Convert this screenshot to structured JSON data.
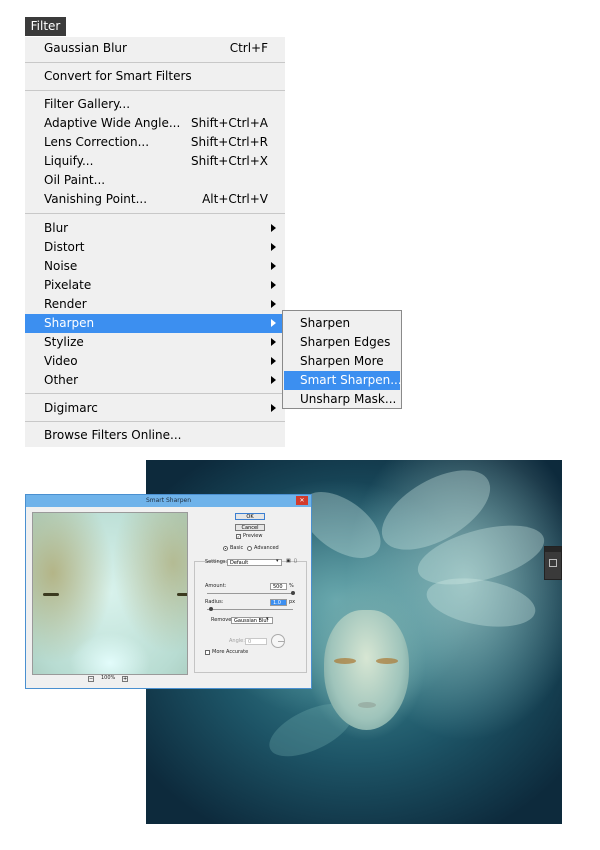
{
  "menubar": {
    "filter_label": "Filter"
  },
  "filter_menu": {
    "items": [
      {
        "label": "Gaussian Blur",
        "shortcut": "Ctrl+F"
      },
      {
        "label": "Convert for Smart Filters",
        "shortcut": ""
      },
      {
        "label": "Filter Gallery...",
        "shortcut": ""
      },
      {
        "label": "Adaptive Wide Angle...",
        "shortcut": "Shift+Ctrl+A"
      },
      {
        "label": "Lens Correction...",
        "shortcut": "Shift+Ctrl+R"
      },
      {
        "label": "Liquify...",
        "shortcut": "Shift+Ctrl+X"
      },
      {
        "label": "Oil Paint...",
        "shortcut": ""
      },
      {
        "label": "Vanishing Point...",
        "shortcut": "Alt+Ctrl+V"
      },
      {
        "label": "Blur",
        "shortcut": ""
      },
      {
        "label": "Distort",
        "shortcut": ""
      },
      {
        "label": "Noise",
        "shortcut": ""
      },
      {
        "label": "Pixelate",
        "shortcut": ""
      },
      {
        "label": "Render",
        "shortcut": ""
      },
      {
        "label": "Sharpen",
        "shortcut": ""
      },
      {
        "label": "Stylize",
        "shortcut": ""
      },
      {
        "label": "Video",
        "shortcut": ""
      },
      {
        "label": "Other",
        "shortcut": ""
      },
      {
        "label": "Digimarc",
        "shortcut": ""
      },
      {
        "label": "Browse Filters Online...",
        "shortcut": ""
      }
    ],
    "highlighted": "Sharpen"
  },
  "sharpen_submenu": {
    "items": [
      "Sharpen",
      "Sharpen Edges",
      "Sharpen More",
      "Smart Sharpen...",
      "Unsharp Mask..."
    ],
    "highlighted": "Smart Sharpen..."
  },
  "dialog": {
    "title": "Smart Sharpen",
    "close_glyph": "✕",
    "ok_label": "OK",
    "cancel_label": "Cancel",
    "preview_label": "Preview",
    "basic_label": "Basic",
    "advanced_label": "Advanced",
    "mode_selected": "Basic",
    "settings_label": "Settings:",
    "settings_value": "Default",
    "amount_label": "Amount:",
    "amount_value": "500",
    "amount_unit": "%",
    "radius_label": "Radius:",
    "radius_value": "1.0",
    "radius_unit": "px",
    "remove_label": "Remove:",
    "remove_value": "Gaussian Blur",
    "angle_label": "Angle:",
    "angle_value": "0",
    "more_accurate_label": "More Accurate",
    "zoom_value": "100%",
    "zoom_out_glyph": "−",
    "zoom_in_glyph": "+",
    "preview_checked": true,
    "more_accurate_checked": false
  },
  "colors": {
    "highlight": "#3c8ff0",
    "menu_bg": "#f0f0f0",
    "dialog_title_bar": "#6fb3ea",
    "close_button": "#d23b2c"
  }
}
